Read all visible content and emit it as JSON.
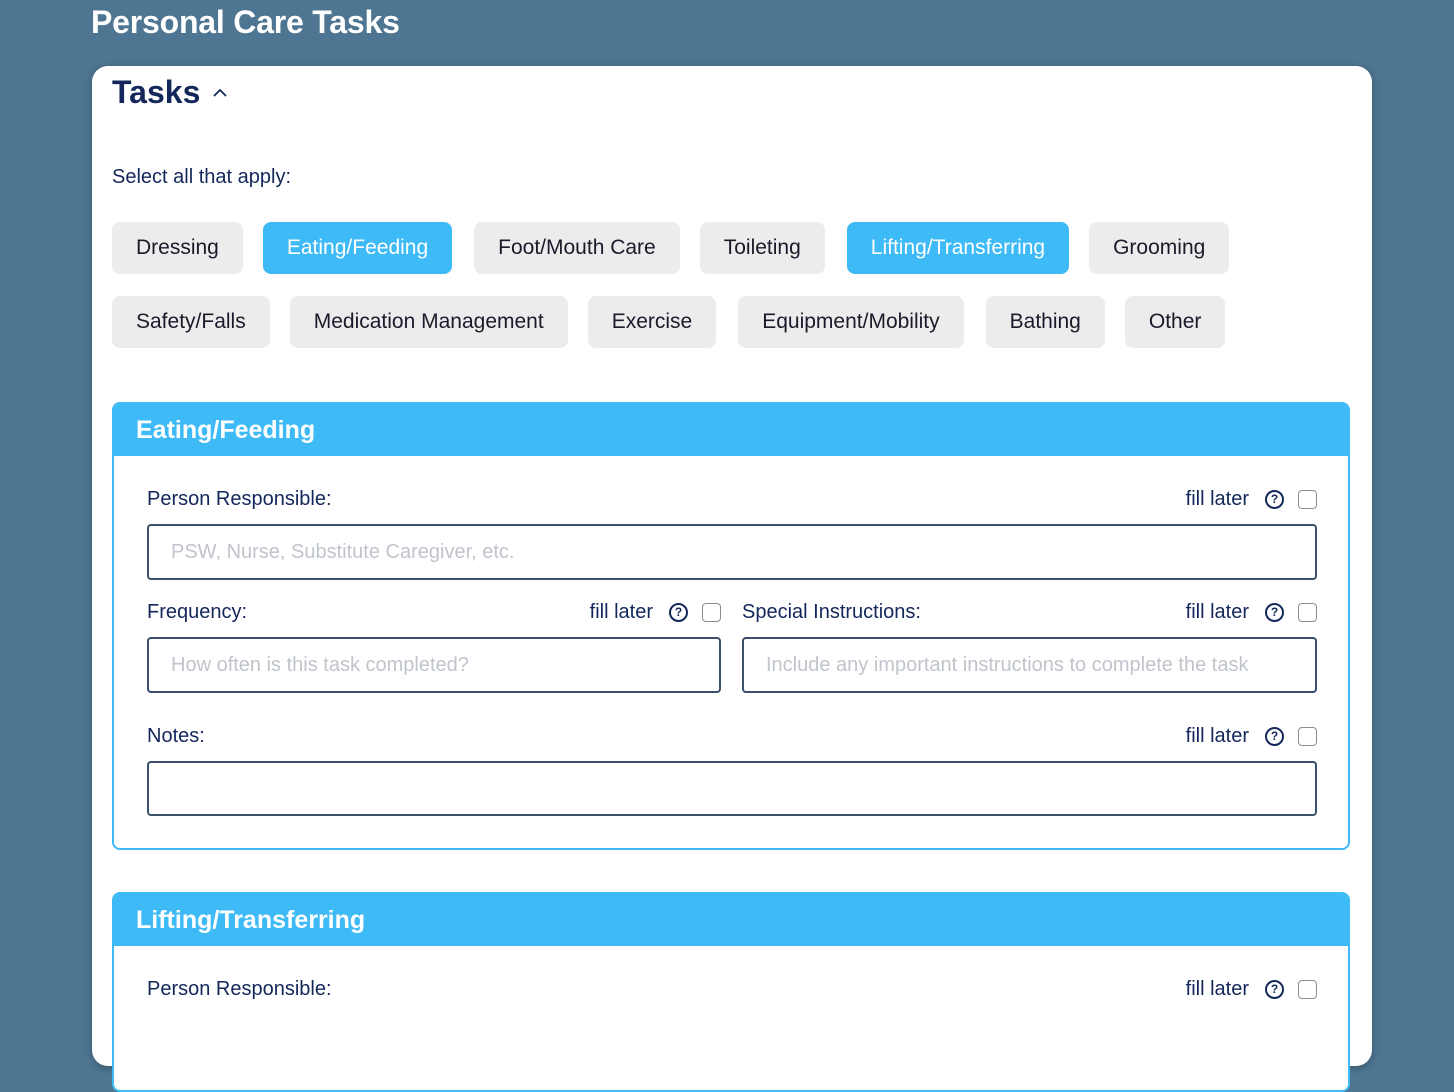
{
  "page": {
    "title": "Personal Care Tasks"
  },
  "tasks": {
    "title": "Tasks",
    "instruction": "Select all that apply:",
    "chips_row1": [
      {
        "label": "Dressing",
        "selected": false
      },
      {
        "label": "Eating/Feeding",
        "selected": true
      },
      {
        "label": "Foot/Mouth Care",
        "selected": false
      },
      {
        "label": "Toileting",
        "selected": false
      },
      {
        "label": "Lifting/Transferring",
        "selected": true
      },
      {
        "label": "Grooming",
        "selected": false
      }
    ],
    "chips_row2": [
      {
        "label": "Safety/Falls",
        "selected": false
      },
      {
        "label": "Medication Management",
        "selected": false
      },
      {
        "label": "Exercise",
        "selected": false
      },
      {
        "label": "Equipment/Mobility",
        "selected": false
      },
      {
        "label": "Bathing",
        "selected": false
      },
      {
        "label": "Other",
        "selected": false
      }
    ]
  },
  "sections": [
    {
      "title": "Eating/Feeding",
      "person_label": "Person Responsible:",
      "person_placeholder": "PSW, Nurse, Substitute Caregiver, etc.",
      "person_value": "",
      "frequency_label": "Frequency:",
      "frequency_placeholder": "How often is this task completed?",
      "frequency_value": "",
      "instructions_label": "Special Instructions:",
      "instructions_placeholder": "Include any important instructions to complete the task",
      "instructions_value": "",
      "notes_label": "Notes:",
      "notes_value": "",
      "fill_later": "fill later",
      "help_glyph": "?"
    },
    {
      "title": "Lifting/Transferring",
      "person_label": "Person Responsible:",
      "fill_later": "fill later",
      "help_glyph": "?"
    }
  ],
  "colors": {
    "background": "#4e7591",
    "accent": "#3ebaf7",
    "text": "#13275a",
    "chip": "#ececec"
  },
  "icons": {
    "collapse": "chevron-up-icon",
    "help": "question-circle-icon"
  }
}
